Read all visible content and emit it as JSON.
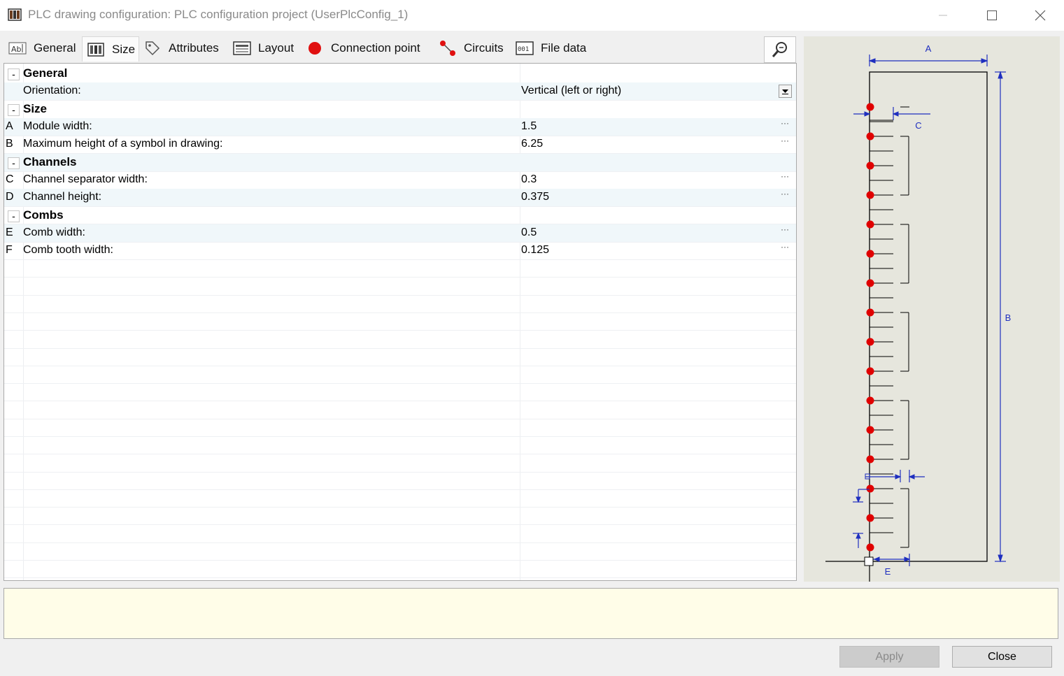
{
  "window": {
    "title": "PLC drawing configuration: PLC configuration project (UserPlcConfig_1)"
  },
  "tabs": [
    {
      "label": "General",
      "icon": "text-field-icon"
    },
    {
      "label": "Size",
      "icon": "module-size-icon",
      "active": true
    },
    {
      "label": "Attributes",
      "icon": "tag-icon"
    },
    {
      "label": "Layout",
      "icon": "layout-icon"
    },
    {
      "label": "Connection point",
      "icon": "red-dot-icon"
    },
    {
      "label": "Circuits",
      "icon": "circuit-icon"
    },
    {
      "label": "File data",
      "icon": "file-data-icon"
    }
  ],
  "grid": {
    "rows": [
      {
        "type": "category",
        "name": "General"
      },
      {
        "type": "prop",
        "letter": "",
        "name": "Orientation:",
        "value": "Vertical (left or right)",
        "dropdown": true
      },
      {
        "type": "category",
        "name": "Size"
      },
      {
        "type": "prop",
        "letter": "A",
        "name": "Module width:",
        "value": "1.5"
      },
      {
        "type": "prop",
        "letter": "B",
        "name": "Maximum height of a symbol in drawing:",
        "value": "6.25"
      },
      {
        "type": "category",
        "name": "Channels"
      },
      {
        "type": "prop",
        "letter": "C",
        "name": "Channel separator width:",
        "value": "0.3"
      },
      {
        "type": "prop",
        "letter": "D",
        "name": "Channel height:",
        "value": "0.375"
      },
      {
        "type": "category",
        "name": "Combs"
      },
      {
        "type": "prop",
        "letter": "E",
        "name": "Comb width:",
        "value": "0.5"
      },
      {
        "type": "prop",
        "letter": "F",
        "name": "Comb tooth width:",
        "value": "0.125"
      }
    ],
    "expander_symbol": "-",
    "ellipsis": "···"
  },
  "preview": {
    "labels": {
      "a": "A",
      "b": "B",
      "c": "C",
      "e": "E"
    },
    "colors": {
      "dimension": "#1f2fbf",
      "connection": "#e00000",
      "line": "#000000"
    }
  },
  "buttons": {
    "apply": "Apply",
    "close": "Close"
  }
}
